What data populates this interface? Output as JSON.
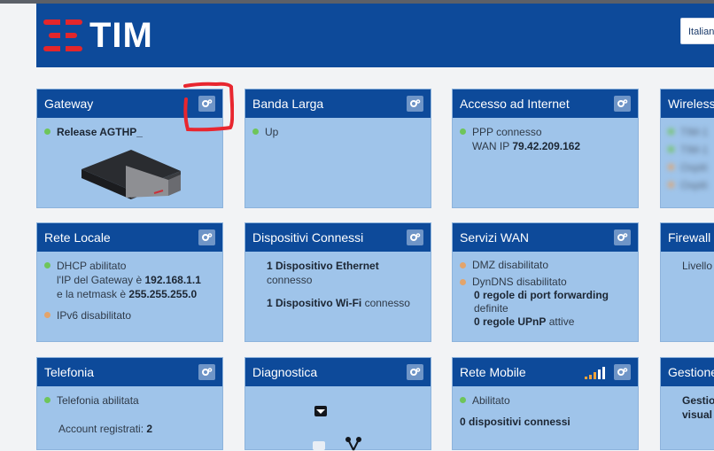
{
  "header": {
    "brand": "TIM",
    "language_label": "Italiano"
  },
  "colors": {
    "header_bg": "#0d4a9a",
    "panel_bg": "#9fc4ea",
    "accent_red": "#e3262b",
    "status_ok": "#6ec55a",
    "status_off": "#e3a46b"
  },
  "panels": {
    "gateway": {
      "title": "Gateway",
      "release": "Release AGTHP_",
      "icon": "gear-icon"
    },
    "broadband": {
      "title": "Banda Larga",
      "status": "Up"
    },
    "internet": {
      "title": "Accesso ad Internet",
      "status": "PPP connesso",
      "wan_label": "WAN IP",
      "wan_ip": "79.42.209.162"
    },
    "wireless": {
      "title": "Wireless",
      "items": [
        "TIM-1",
        "TIM-1",
        "Ospiti",
        "Ospiti"
      ]
    },
    "lan": {
      "title": "Rete Locale",
      "dhcp": "DHCP abilitato",
      "gw_label": "l'IP del Gateway è",
      "gw_ip": "192.168.1.1",
      "mask_label": "e la netmask è",
      "mask": "255.255.255.0",
      "ipv6": "IPv6 disabilitato"
    },
    "devices": {
      "title": "Dispositivi Connessi",
      "ethernet_bold": "1 Dispositivo Ethernet",
      "ethernet_rest": "connesso",
      "wifi_bold": "1 Dispositivo Wi-Fi",
      "wifi_rest": "connesso"
    },
    "wan": {
      "title": "Servizi WAN",
      "dmz": "DMZ disabilitato",
      "dyndns": "DynDNS disabilitato",
      "pf_bold": "0 regole di port forwarding",
      "pf_rest": "definite",
      "upnp_bold": "0 regole UPnP",
      "upnp_rest": "attive"
    },
    "firewall": {
      "title": "Firewall",
      "level": "Livello"
    },
    "telephony": {
      "title": "Telefonia",
      "status": "Telefonia abilitata",
      "accounts_label": "Account registrati:",
      "accounts": "2"
    },
    "diagnostics": {
      "title": "Diagnostica"
    },
    "mobile": {
      "title": "Rete Mobile",
      "status": "Abilitato",
      "devices_bold": "0 dispositivi connessi"
    },
    "management": {
      "title": "Gestione",
      "line1": "Gestio",
      "line2": "visual"
    }
  }
}
